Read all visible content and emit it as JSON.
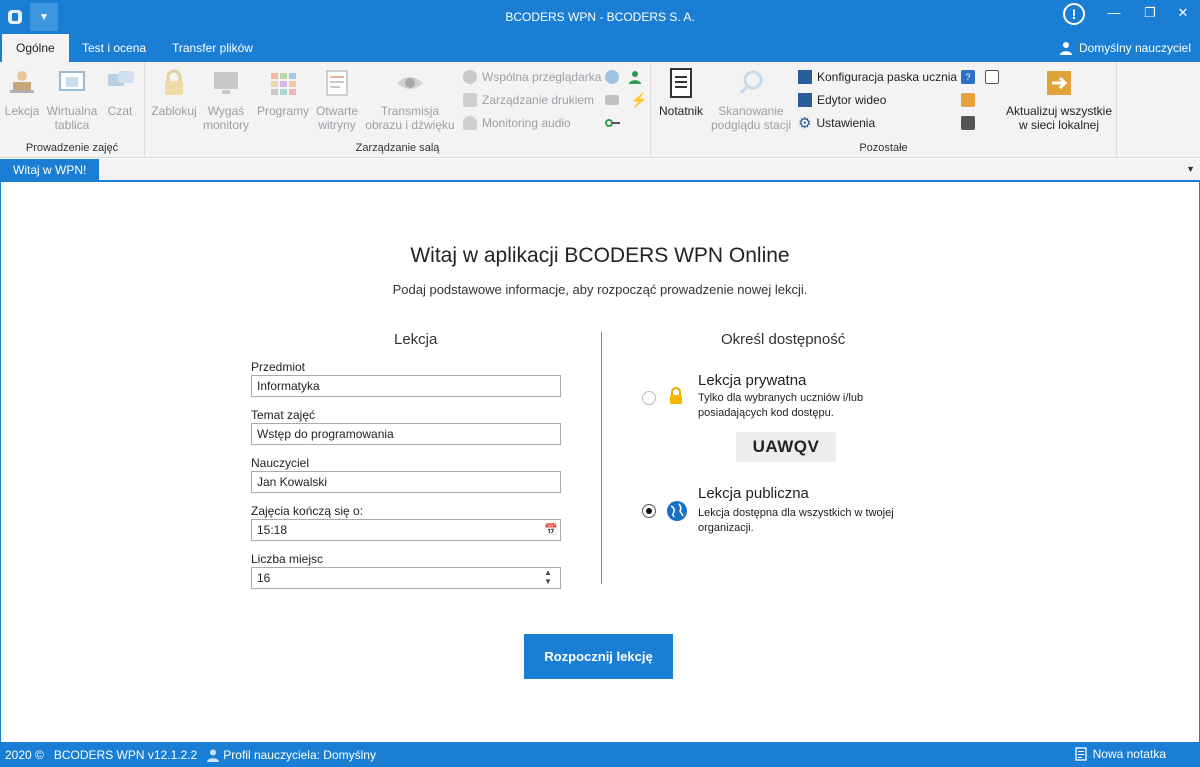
{
  "window": {
    "title": "BCODERS WPN - BCODERS S. A."
  },
  "ribbon_tabs": [
    "Ogólne",
    "Test i ocena",
    "Transfer plików"
  ],
  "user": {
    "name": "Domyślny nauczyciel"
  },
  "groups": {
    "prowadzenie": {
      "label": "Prowadzenie zajęć",
      "items": {
        "lekcja": "Lekcja",
        "tablica_1": "Wirtualna",
        "tablica_2": "tablica",
        "czat": "Czat"
      }
    },
    "zarzadzanie": {
      "label": "Zarządzanie salą",
      "items": {
        "zablokuj": "Zablokuj",
        "wygas_1": "Wygaś",
        "wygas_2": "monitory",
        "programy": "Programy",
        "otwarte_1": "Otwarte",
        "otwarte_2": "witryny",
        "transmisja_1": "Transmisja",
        "transmisja_2": "obrazu i dźwięku",
        "przegladarka": "Wspólna przeglądarka",
        "druk": "Zarządzanie drukiem",
        "audio": "Monitoring audio"
      }
    },
    "pozostale": {
      "label": "Pozostałe",
      "items": {
        "notatnik": "Notatnik",
        "skan_1": "Skanowanie",
        "skan_2": "podglądu stacji",
        "konfiguracja": "Konfiguracja paska ucznia",
        "edytor": "Edytor wideo",
        "ustawienia": "Ustawienia"
      }
    },
    "aktualizuj": {
      "line1": "Aktualizuj wszystkie",
      "line2": "w sieci lokalnej"
    }
  },
  "doc_tab": "Witaj w WPN!",
  "welcome": {
    "heading": "Witaj w aplikacji BCODERS WPN Online",
    "subtitle": "Podaj podstawowe informacje, aby rozpocząć prowadzenie nowej lekcji."
  },
  "lesson": {
    "title": "Lekcja",
    "fields": {
      "przedmiot": {
        "label": "Przedmiot",
        "value": "Informatyka"
      },
      "temat": {
        "label": "Temat zajęć",
        "value": "Wstęp do programowania"
      },
      "nauczyciel": {
        "label": "Nauczyciel",
        "value": "Jan Kowalski"
      },
      "koniec": {
        "label": "Zajęcia kończą się o:",
        "value": "15:18"
      },
      "miejsca": {
        "label": "Liczba miejsc",
        "value": "16"
      }
    }
  },
  "availability": {
    "title": "Określ dostępność",
    "private": {
      "title": "Lekcja prywatna",
      "desc": "Tylko dla wybranych uczniów i/lub posiadających kod dostępu.",
      "code": "UAWQV",
      "selected": false
    },
    "public": {
      "title": "Lekcja publiczna",
      "desc": "Lekcja dostępna dla wszystkich w twojej organizacji.",
      "selected": true
    }
  },
  "start_button": "Rozpocznij lekcję",
  "status": {
    "year": "2020 ©",
    "version": "BCODERS WPN v12.1.2.2",
    "profile": "Profil nauczyciela: Domyślny",
    "new_note": "Nowa notatka"
  },
  "colors": {
    "accent": "#1a7fd4",
    "disabled": "#9aa0a6"
  },
  "icons": [
    "app-icon",
    "dropdown-icon",
    "alert-icon",
    "minimize-icon",
    "restore-icon",
    "close-icon",
    "user-icon",
    "lock-icon",
    "globe-icon",
    "calendar-icon",
    "spinner-icon",
    "note-icon"
  ]
}
